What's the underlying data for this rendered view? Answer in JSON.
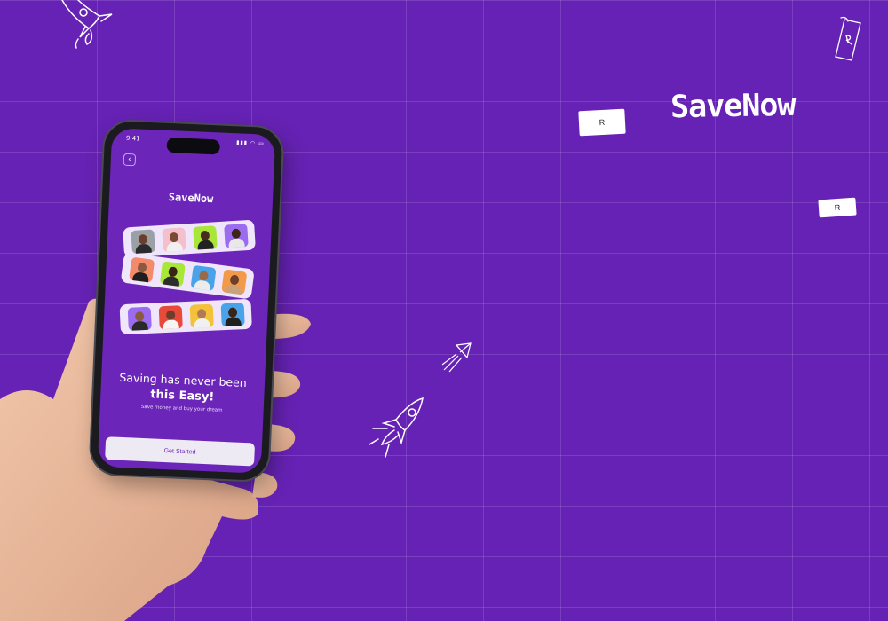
{
  "brand": {
    "name": "SaveNow"
  },
  "currency_symbol": "R",
  "phone": {
    "status_time": "9:41",
    "app_logo": "SaveNow",
    "headline_line1": "Saving has never been",
    "headline_line2": "this  Easy!",
    "subtitle": "Save money and buy your dream",
    "cta_label": "Get Started"
  },
  "colors": {
    "background": "#6622b4",
    "screen": "#6b25b9",
    "strip": "#efe6fb"
  }
}
